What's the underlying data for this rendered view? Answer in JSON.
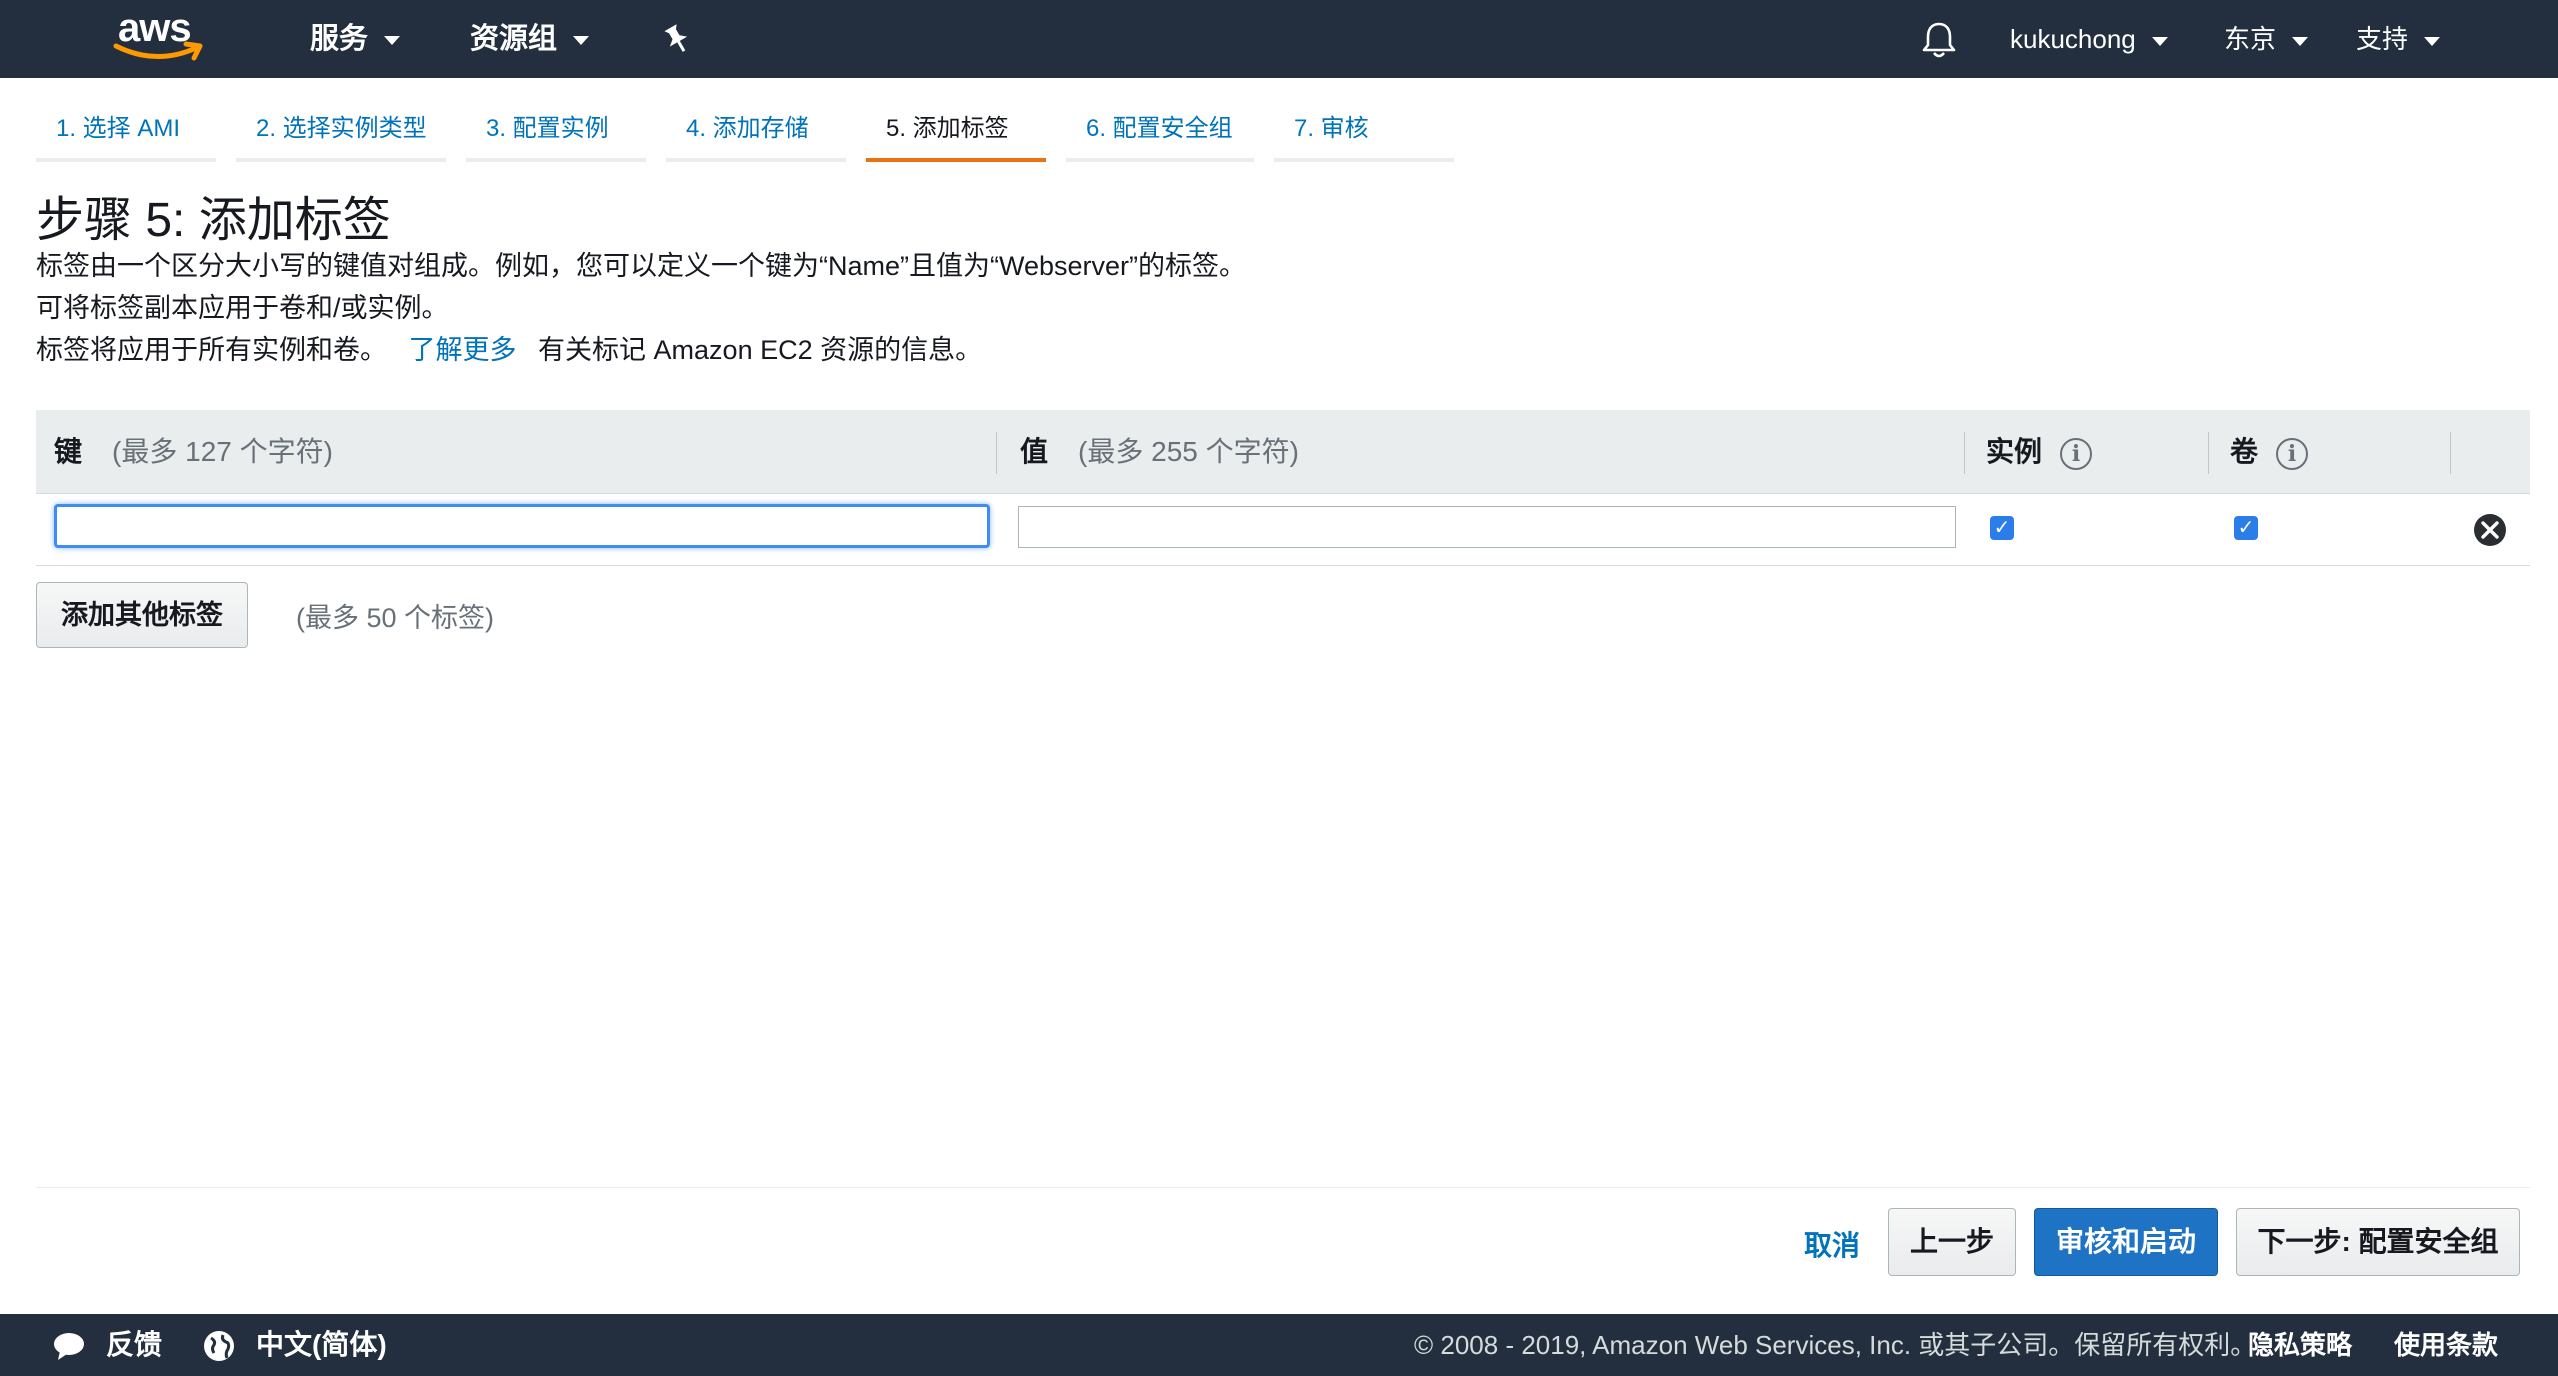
{
  "nav": {
    "logo": "aws",
    "services": "服务",
    "resource_groups": "资源组",
    "user": "kukuchong",
    "region": "东京",
    "support": "支持"
  },
  "steps": [
    {
      "label": "1. 选择 AMI"
    },
    {
      "label": "2. 选择实例类型"
    },
    {
      "label": "3. 配置实例"
    },
    {
      "label": "4. 添加存储"
    },
    {
      "label": "5. 添加标签",
      "active": true
    },
    {
      "label": "6. 配置安全组"
    },
    {
      "label": "7. 审核"
    }
  ],
  "page": {
    "title": "步骤 5: 添加标签",
    "desc1": "标签由一个区分大小写的键值对组成。例如，您可以定义一个键为“Name”且值为“Webserver”的标签。",
    "desc2": "可将标签副本应用于卷和/或实例。",
    "desc3_prefix": "标签将应用于所有实例和卷。",
    "learn_more": "了解更多",
    "desc3_suffix": "有关标记 Amazon EC2 资源的信息。"
  },
  "table": {
    "key_header": "键",
    "key_hint": "(最多 127 个字符)",
    "value_header": "值",
    "value_hint": "(最多 255 个字符)",
    "instance_header": "实例",
    "volume_header": "卷",
    "row": {
      "key": "",
      "value": "",
      "instance_checked": true,
      "volume_checked": true
    }
  },
  "add_tag": {
    "button": "添加其他标签",
    "hint": "(最多 50 个标签)"
  },
  "actions": {
    "cancel": "取消",
    "previous": "上一步",
    "review_launch": "审核和启动",
    "next": "下一步: 配置安全组"
  },
  "footer": {
    "feedback": "反馈",
    "language": "中文(简体)",
    "copyright": "© 2008 - 2019, Amazon Web Services, Inc. 或其子公司。保留所有权利。",
    "privacy": "隐私策略",
    "terms": "使用条款"
  },
  "colors": {
    "nav_bg": "#232f3e",
    "link": "#0073bb",
    "active_step": "#ec7211",
    "primary_button": "#1f73c4",
    "checkbox": "#2b7de9"
  }
}
